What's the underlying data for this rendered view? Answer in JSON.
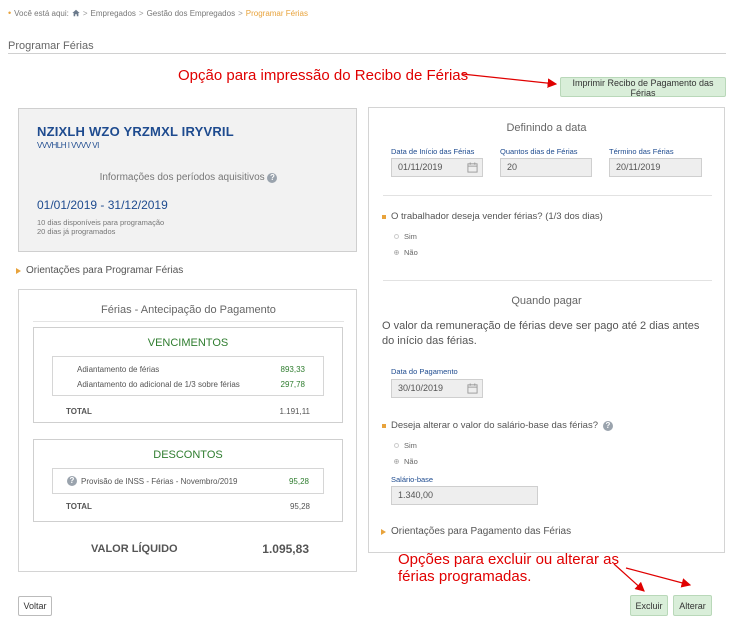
{
  "breadcrumb": {
    "prefix": "Você está aqui:",
    "items": [
      "Empregados",
      "Gestão dos Empregados"
    ],
    "current": "Programar Férias"
  },
  "page_title": "Programar Férias",
  "annotations": {
    "print": "Opção para impressão do Recibo de Férias",
    "edit": "Opções para excluir ou alterar as férias programadas."
  },
  "buttons": {
    "print": "Imprimir Recibo de Pagamento das Férias",
    "voltar": "Voltar",
    "excluir": "Excluir",
    "alterar": "Alterar"
  },
  "employee": {
    "name": "NZIXLH WZO YRZMXL IRYVRIL",
    "subtitle": "VVVHLH I VVVV VI",
    "periodos_label": "Informações dos períodos aquisitivos",
    "periodo": "01/01/2019 - 31/12/2019",
    "dias_disponiveis": "10 dias disponíveis para programação",
    "dias_programados": "20 dias já programados"
  },
  "orientacoes_programar": "Orientações para Programar Férias",
  "antecipacao": {
    "title": "Férias - Antecipação do Pagamento",
    "vencimentos": {
      "title": "VENCIMENTOS",
      "rows": [
        {
          "label": "Adiantamento de férias",
          "value": "893,33"
        },
        {
          "label": "Adiantamento do adicional de 1/3 sobre férias",
          "value": "297,78"
        }
      ],
      "total_label": "TOTAL",
      "total_value": "1.191,11"
    },
    "descontos": {
      "title": "DESCONTOS",
      "rows": [
        {
          "label": "Provisão de INSS - Férias - Novembro/2019",
          "value": "95,28"
        }
      ],
      "total_label": "TOTAL",
      "total_value": "95,28"
    },
    "liquido_label": "VALOR LÍQUIDO",
    "liquido_value": "1.095,83"
  },
  "definindo": {
    "title": "Definindo a data",
    "inicio_label": "Data de Início das Férias",
    "inicio_value": "01/11/2019",
    "dias_label": "Quantos dias de Férias",
    "dias_value": "20",
    "termino_label": "Término das Férias",
    "termino_value": "20/11/2019",
    "vender_question": "O trabalhador deseja vender férias? (1/3 dos dias)",
    "opt_sim": "Sim",
    "opt_nao": "Não",
    "vender_selected": "Não"
  },
  "quando_pagar": {
    "title": "Quando pagar",
    "text": "O valor da remuneração de férias deve ser pago até 2 dias antes do início das férias.",
    "pagamento_label": "Data do Pagamento",
    "pagamento_value": "30/10/2019",
    "salario_question": "Deseja alterar o valor do salário-base das férias?",
    "opt_sim": "Sim",
    "opt_nao": "Não",
    "salario_selected": "Não",
    "salario_label": "Salário-base",
    "salario_value": "1.340,00"
  },
  "orientacoes_pagamento": "Orientações para Pagamento das Férias",
  "colors": {
    "accent_orange": "#e8a33c",
    "blue_text": "#1e4b8f",
    "green_text": "#2f7d2f",
    "button_green": "#d9eed9",
    "annotation_red": "#e00000"
  }
}
